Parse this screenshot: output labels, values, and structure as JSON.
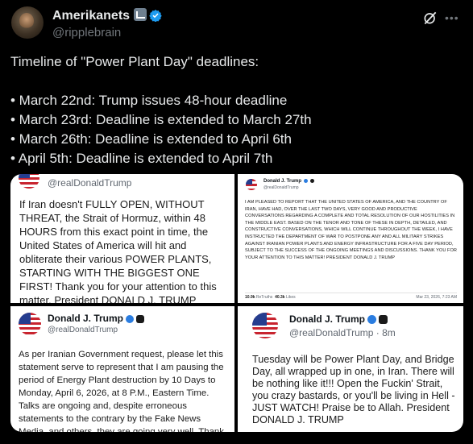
{
  "author": {
    "display_name": "Amerikanets",
    "handle": "@ripplebrain"
  },
  "icons": {
    "avatar": "avatar",
    "flair": "flag-flair-icon",
    "verified": "verified-badge-icon",
    "grok": "grok-icon",
    "more": "more-icon"
  },
  "tweet": {
    "title_line": "Timeline of \"Power Plant Day\" deadlines:",
    "items": [
      "• March 22nd: Trump issues 48-hour deadline",
      "• March 23rd: Deadline is extended to March 27th",
      "• March 26th: Deadline is extended to April 6th",
      "• April 5th: Deadline is extended to April 7th"
    ]
  },
  "media": {
    "top_left": {
      "handle": "@realDonaldTrump",
      "body": "If Iran doesn't FULLY OPEN, WITHOUT THREAT, the Strait of Hormuz, within 48 HOURS from this exact point in time, the United States of America will hit and obliterate their various POWER PLANTS, STARTING WITH THE BIGGEST ONE FIRST! Thank you for your attention to this matter. President DONALD J. TRUMP"
    },
    "top_right": {
      "name": "Donald J. Trump",
      "handle": "@realDonaldTrump",
      "body": "I AM PLEASED TO REPORT THAT THE UNITED STATES OF AMERICA, AND THE COUNTRY OF IRAN, HAVE HAD, OVER THE LAST TWO DAYS, VERY GOOD AND PRODUCTIVE CONVERSATIONS REGARDING A COMPLETE AND TOTAL RESOLUTION OF OUR HOSTILITIES IN THE MIDDLE EAST. BASED ON THE TENOR AND TONE OF THESE IN DEPTH, DETAILED, AND CONSTRUCTIVE CONVERSATIONS, WHICH WILL CONTINUE THROUGHOUT THE WEEK, I HAVE INSTRUCTED THE DEPARTMENT OF WAR TO POSTPONE ANY AND ALL MILITARY STRIKES AGAINST IRANIAN POWER PLANTS AND ENERGY INFRASTRUCTURE FOR A FIVE DAY PERIOD, SUBJECT TO THE SUCCESS OF THE ONGOING MEETINGS AND DISCUSSIONS. THANK YOU FOR YOUR ATTENTION TO THIS MATTER! PRESIDENT DONALD J. TRUMP",
      "retruths_count": "10.9k",
      "retruths_label": "ReTruths",
      "likes_count": "40.3k",
      "likes_label": "Likes",
      "date": "Mar 23, 2026, 7:23 AM"
    },
    "bottom_left": {
      "name": "Donald J. Trump",
      "handle": "@realDonaldTrump",
      "body": "As per Iranian Government request, please let this statement serve to represent that I am pausing the period of Energy Plant destruction by 10 Days to Monday, April 6, 2026, at 8 P.M., Eastern Time. Talks are ongoing and, despite erroneous statements to the contrary by the Fake News Media, and others, they are going very well. Thank you for your attention to this matter! President DONALD J. TRUMP"
    },
    "bottom_right": {
      "name": "Donald J. Trump",
      "handle": "@realDonaldTrump",
      "time": "· 8m",
      "body": "Tuesday will be Power Plant Day, and Bridge Day, all wrapped up in one, in Iran. There will be nothing like it!!! Open the Fuckin' Strait, you crazy bastards, or you'll be living in Hell - JUST WATCH! Praise be to Allah. President DONALD J. TRUMP"
    }
  }
}
